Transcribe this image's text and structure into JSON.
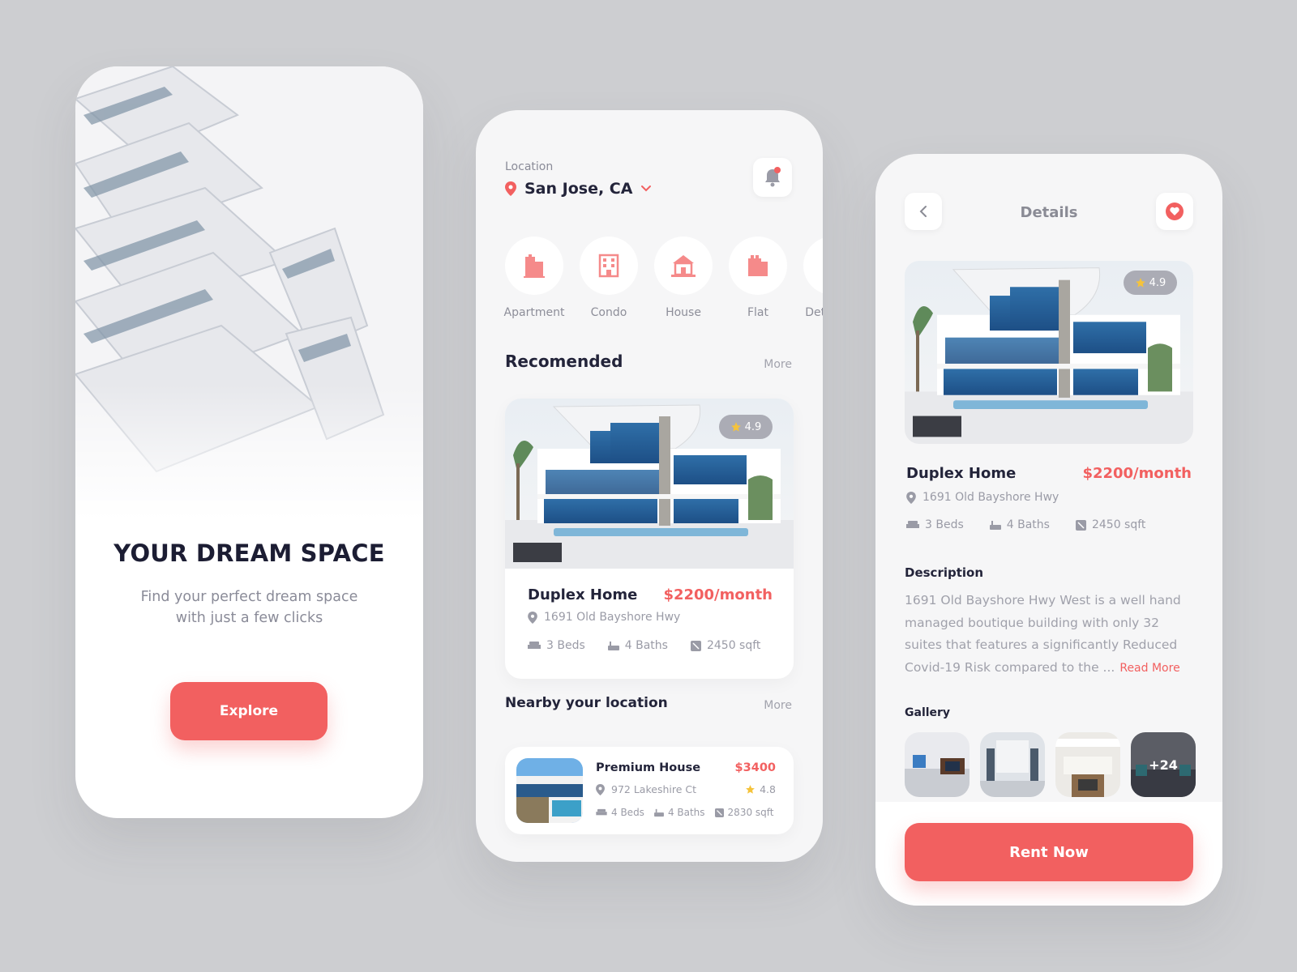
{
  "colors": {
    "accent": "#f26060",
    "background": "#cdced1",
    "text_dark": "#23243a",
    "text_muted": "#9a9ba6",
    "star": "#f5c33b"
  },
  "onboarding": {
    "title": "YOUR DREAM SPACE",
    "subtitle": "Find your perfect dream space with just a few clicks",
    "explore_button": "Explore"
  },
  "home": {
    "location_label": "Location",
    "location_value": "San Jose, CA",
    "notification_icon": "bell-icon",
    "categories": [
      {
        "label": "Apartment",
        "icon": "apartment-icon"
      },
      {
        "label": "Condo",
        "icon": "condo-icon"
      },
      {
        "label": "House",
        "icon": "house-icon"
      },
      {
        "label": "Flat",
        "icon": "flat-icon"
      },
      {
        "label": "Detached",
        "icon": "detached-icon"
      }
    ],
    "recommended": {
      "title": "Recomended",
      "more": "More",
      "card": {
        "rating": "4.9",
        "name": "Duplex Home",
        "price": "$2200/month",
        "address": "1691 Old Bayshore Hwy",
        "beds": "3 Beds",
        "baths": "4 Baths",
        "area": "2450 sqft"
      }
    },
    "nearby": {
      "title": "Nearby your location",
      "more": "More",
      "card": {
        "name": "Premium House",
        "price": "$3400",
        "address": "972 Lakeshire Ct",
        "rating": "4.8",
        "beds": "4 Beds",
        "baths": "4 Baths",
        "area": "2830 sqft"
      }
    }
  },
  "details": {
    "title": "Details",
    "back_icon": "chevron-left-icon",
    "favorite_icon": "heart-icon",
    "rating": "4.9",
    "name": "Duplex Home",
    "price": "$2200/month",
    "address": "1691 Old Bayshore Hwy",
    "beds": "3 Beds",
    "baths": "4 Baths",
    "area": "2450 sqft",
    "description_title": "Description",
    "description": "1691 Old Bayshore Hwy West is a well hand managed boutique building with only 32 suites  that features a significantly Reduced Covid-19 Risk compared to the ...",
    "read_more": "Read More",
    "gallery_title": "Gallery",
    "gallery_more_count": "+24",
    "rent_button": "Rent Now"
  }
}
